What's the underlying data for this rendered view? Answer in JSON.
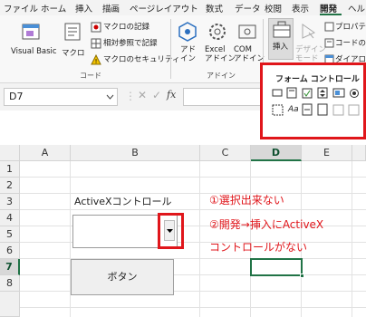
{
  "menu": {
    "items": [
      "ファイル",
      "ホーム",
      "挿入",
      "描画",
      "ページレイアウト",
      "数式",
      "データ",
      "校閲",
      "表示",
      "開発",
      "ヘルプ"
    ],
    "active": "開発"
  },
  "ribbon": {
    "code_group": {
      "visual_basic": "Visual Basic",
      "macro": "マクロ",
      "record_macro": "マクロの記録",
      "relative_ref": "相対参照で記録",
      "macro_security": "マクロのセキュリティ",
      "label": "コード"
    },
    "addin_group": {
      "addin": "アド\nイン",
      "excel_addin": "Excel\nアドイン",
      "com_addin": "COM\nアドイン",
      "label": "アドイン"
    },
    "controls_group": {
      "insert": "挿入",
      "design_mode": "デザイン\nモード",
      "properties": "プロパティ",
      "view_code": "コードの表示",
      "dialog": "ダイアログ"
    }
  },
  "insert_dropdown": {
    "title": "フォーム コントロール",
    "aa_label": "Aa"
  },
  "formula_bar": {
    "name_box": "D7",
    "fx": "fx"
  },
  "sheet": {
    "columns": [
      "A",
      "B",
      "C",
      "D",
      "E"
    ],
    "rows": [
      "1",
      "2",
      "3",
      "4",
      "5",
      "6",
      "7",
      "8"
    ],
    "active_cell": "D7"
  },
  "content": {
    "label_activex": "ActiveXコントロール",
    "button_label": "ボタン",
    "note1": "①選択出来ない",
    "note2": "②開発→挿入にActiveX",
    "note3": "コントロールがない"
  }
}
